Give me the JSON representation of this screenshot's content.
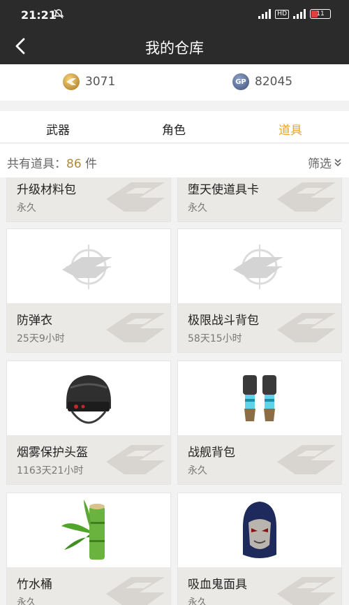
{
  "status": {
    "time": "21:21",
    "battery": "11"
  },
  "header": {
    "title": "我的仓库"
  },
  "currency": {
    "gold": "3071",
    "gp": "82045",
    "gp_label": "GP"
  },
  "tabs": [
    "武器",
    "角色",
    "道具"
  ],
  "summary": {
    "prefix": "共有道具：",
    "count": "86",
    "suffix": " 件",
    "filter": "筛选"
  },
  "items": [
    {
      "name": "升级材料包",
      "duration": "永久"
    },
    {
      "name": "堕天使道具卡",
      "duration": "永久"
    },
    {
      "name": "防弹衣",
      "duration": "25天9小时"
    },
    {
      "name": "极限战斗背包",
      "duration": "58天15小时"
    },
    {
      "name": "烟雾保护头盔",
      "duration": "1163天21小时"
    },
    {
      "name": "战舰背包",
      "duration": "永久"
    },
    {
      "name": "竹水桶",
      "duration": "永久"
    },
    {
      "name": "吸血鬼面具",
      "duration": "永久"
    }
  ],
  "colors": {
    "header_bg": "#2b2b2b",
    "active_tab": "#e5a637",
    "count_accent": "#b08a3c"
  }
}
